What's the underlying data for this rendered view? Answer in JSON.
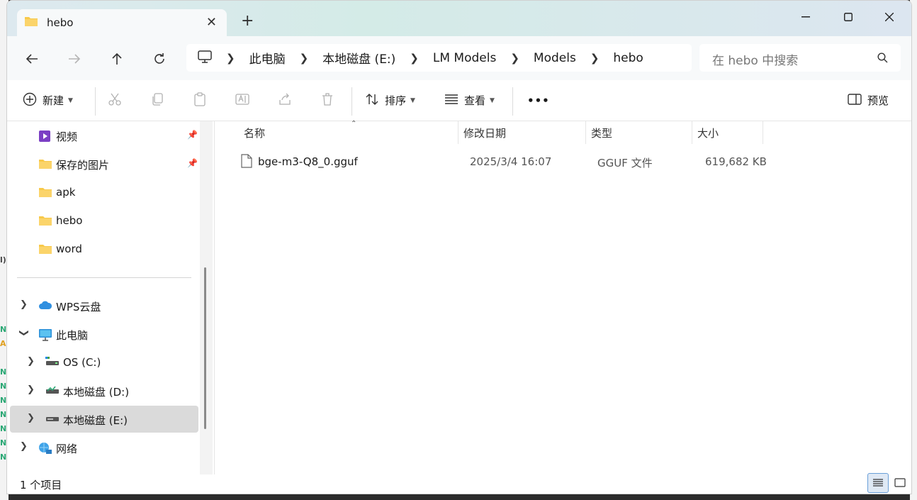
{
  "tab": {
    "title": "hebo"
  },
  "address": {
    "crumbs": [
      "此电脑",
      "本地磁盘 (E:)",
      "LM Models",
      "Models",
      "hebo"
    ]
  },
  "search": {
    "placeholder": "在 hebo 中搜索"
  },
  "commands": {
    "new": "新建",
    "sort": "排序",
    "view": "查看",
    "more": "•••",
    "preview": "预览"
  },
  "sidebar": {
    "quick_access": [
      {
        "label": "视频",
        "icon": "video-folder-icon",
        "pinned": true
      },
      {
        "label": "保存的图片",
        "icon": "folder-icon",
        "pinned": true
      },
      {
        "label": "apk",
        "icon": "folder-icon",
        "pinned": false
      },
      {
        "label": "hebo",
        "icon": "folder-icon",
        "pinned": false
      },
      {
        "label": "word",
        "icon": "folder-icon",
        "pinned": false
      }
    ],
    "tree": [
      {
        "label": "WPS云盘",
        "icon": "cloud-icon",
        "expanded": false
      },
      {
        "label": "此电脑",
        "icon": "computer-icon",
        "expanded": true
      },
      {
        "label": "OS (C:)",
        "icon": "drive-icon"
      },
      {
        "label": "本地磁盘 (D:)",
        "icon": "drive-icon"
      },
      {
        "label": "本地磁盘 (E:)",
        "icon": "drive-icon",
        "selected": true
      },
      {
        "label": "网络",
        "icon": "network-icon",
        "expanded": false
      }
    ]
  },
  "columns": {
    "name": "名称",
    "modified": "修改日期",
    "type": "类型",
    "size": "大小"
  },
  "files": [
    {
      "name": "bge-m3-Q8_0.gguf",
      "modified": "2025/3/4 16:07",
      "type": "GGUF 文件",
      "size": "619,682 KB"
    }
  ],
  "status": {
    "count": "1 个项目"
  },
  "colors": {
    "folder": "#f8c94a",
    "selected_bg": "#dadada",
    "accent": "#1a73c8"
  }
}
